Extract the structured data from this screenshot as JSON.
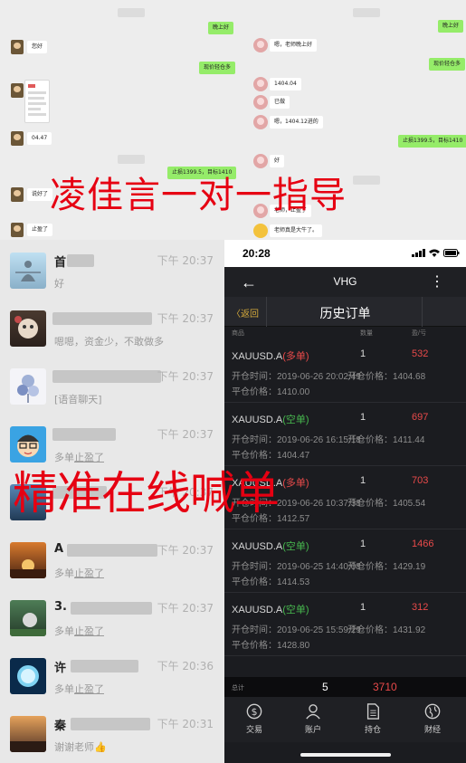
{
  "top_chat": {
    "messages": {
      "m1": "晚上好",
      "m2": "您好",
      "m3": "嗯，老师晚上好",
      "m4": "晚上好",
      "m5": "现价轻仓多",
      "m6": "现价轻仓多",
      "m7": "1404.04",
      "m8": "已做",
      "m9": "嗯，1404.12进的",
      "m10": "04.47",
      "m11": "止损1399.5，目标1410",
      "m12": "好",
      "m13": "止损1399.5，目标1410",
      "m14": "说好了",
      "m15": "老师，止盈了",
      "m16": "止盈了",
      "m17": "老师真是大牛了。"
    },
    "overlay_text": "凌佳言一对一指导"
  },
  "chat_list": [
    {
      "name": "首",
      "time": "下午 20:37",
      "preview": "好",
      "avatar": "meditation-avatar"
    },
    {
      "name": "",
      "time": "下午 20:37",
      "preview": "嗯嗯，资金少，不敢做多",
      "avatar": "cat-avatar"
    },
    {
      "name": "",
      "time": "下午 20:37",
      "preview": "[语音聊天]",
      "avatar": "flower-avatar"
    },
    {
      "name": "",
      "time": "下午 20:37",
      "preview_pre": "多单",
      "preview_link": "止盈了",
      "avatar": "cartoon-avatar"
    },
    {
      "name": "",
      "time": "下午 20:37",
      "preview": "",
      "avatar": "sea-avatar"
    },
    {
      "name": "A",
      "time": "下午 20:37",
      "preview_pre": "多单",
      "preview_link": "止盈了",
      "avatar": "sunset-avatar"
    },
    {
      "name": "3.",
      "time": "下午 20:37",
      "preview_pre": "多单",
      "preview_link": "止盈了",
      "avatar": "ball-avatar"
    },
    {
      "name": "许",
      "time": "下午 20:36",
      "preview_pre": "多单",
      "preview_link": "止盈了",
      "avatar": "moon-avatar"
    },
    {
      "name": "秦",
      "time": "下午 20:31",
      "preview": "谢谢老师👍",
      "avatar": "dusk-avatar"
    }
  ],
  "chat_list_overlay": "精准在线喊单",
  "app": {
    "status_time": "20:28",
    "header_title": "VHG",
    "back_label": "〈返回",
    "sub_title": "历史订单",
    "columns": {
      "product": "商品",
      "qty": "数量",
      "pl": "盈/亏"
    },
    "orders": [
      {
        "symbol": "XAUUSD.A",
        "dir": "(多单)",
        "dir_type": "long",
        "qty": "1",
        "pl": "532",
        "open_time": "开仓时间：2019-06-26 20:02:49",
        "open_price": "开仓价格：1404.68",
        "close_price": "平仓价格：1410.00"
      },
      {
        "symbol": "XAUUSD.A",
        "dir": "(空单)",
        "dir_type": "short",
        "qty": "1",
        "pl": "697",
        "open_time": "开仓时间：2019-06-26 16:15:18",
        "open_price": "开仓价格：1411.44",
        "close_price": "平仓价格：1404.47"
      },
      {
        "symbol": "XAUUSD.A",
        "dir": "(多单)",
        "dir_type": "long",
        "qty": "1",
        "pl": "703",
        "open_time": "开仓时间：2019-06-26 10:37:38",
        "open_price": "开仓价格：1405.54",
        "close_price": "平仓价格：1412.57"
      },
      {
        "symbol": "XAUUSD.A",
        "dir": "(空单)",
        "dir_type": "short",
        "qty": "1",
        "pl": "1466",
        "open_time": "开仓时间：2019-06-25 14:40:08",
        "open_price": "开仓价格：1429.19",
        "close_price": "平仓价格：1414.53"
      },
      {
        "symbol": "XAUUSD.A",
        "dir": "(空单)",
        "dir_type": "short",
        "qty": "1",
        "pl": "312",
        "open_time": "开仓时间：2019-06-25 15:59:29",
        "open_price": "开仓价格：1431.92",
        "close_price": "平仓价格：1428.80"
      }
    ],
    "total": {
      "label": "总计",
      "count": "5",
      "amount": "3710"
    },
    "tabs": [
      {
        "label": "交易",
        "icon": "dollar-icon"
      },
      {
        "label": "账户",
        "icon": "person-icon"
      },
      {
        "label": "持仓",
        "icon": "document-icon"
      },
      {
        "label": "财经",
        "icon": "globe-icon"
      }
    ],
    "colors": {
      "long": "#e94a4a",
      "short": "#47b84e",
      "profit": "#e94a4a",
      "back": "#d4a93b"
    }
  }
}
